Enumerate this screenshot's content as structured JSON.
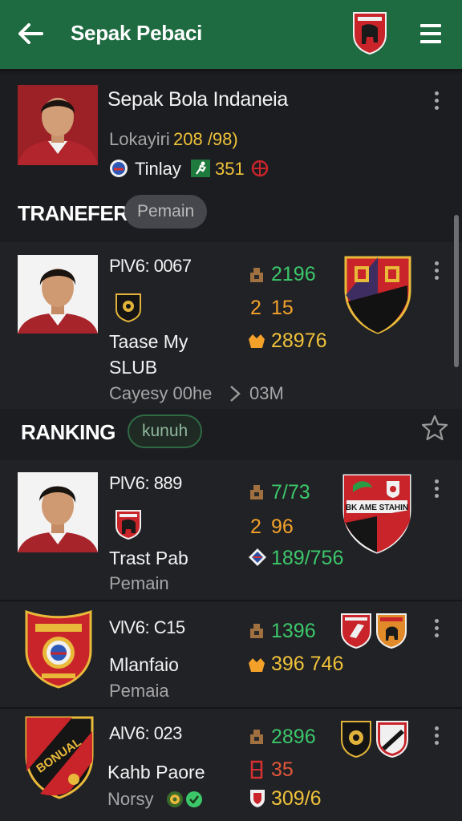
{
  "header": {
    "title": "Sepak Pebaci"
  },
  "profile": {
    "name": "Sepak Bola Indaneia",
    "location_label": "Lokayiri",
    "location_value": "208 /98)",
    "team_label": "Tinlay",
    "score": "351"
  },
  "section_transfer": {
    "label": "TRANEFER",
    "pill": "Pemain"
  },
  "section_ranking": {
    "label": "RANKING",
    "pill": "kunuh"
  },
  "cards": [
    {
      "code": "PlV6: 0067",
      "name_line1": "Taase My",
      "name_line2": "SLUB",
      "sub": "Cayesy 00he",
      "sub_value": "03M",
      "stat1": "2196",
      "stat2_a": "2",
      "stat2_b": "15",
      "stat3": "28976"
    },
    {
      "code": "PlV6: 889",
      "name": "Trast Pab",
      "sub": "Pemain",
      "stat1": "7/73",
      "stat2_a": "2",
      "stat2_b": "96",
      "stat3": "189/756",
      "crest_text": "BK AME STAHIN"
    },
    {
      "code": "VlV6: C15",
      "name": "Mlanfaio",
      "sub": "Pemaia",
      "stat1": "1396",
      "stat3": "396 746"
    },
    {
      "code": "AlV6: 023",
      "name": "Kahb Paore",
      "sub": "Norsy",
      "stat1": "2896",
      "stat2_b": "35",
      "stat3": "309/6",
      "crest_text": "BONUAL"
    }
  ],
  "colors": {
    "appbar": "#1f6b41",
    "background": "#1c1d20",
    "card": "#212226",
    "green_stat": "#3cc76a",
    "yellow_stat": "#f0c23a",
    "crest_red": "#c8242a"
  }
}
